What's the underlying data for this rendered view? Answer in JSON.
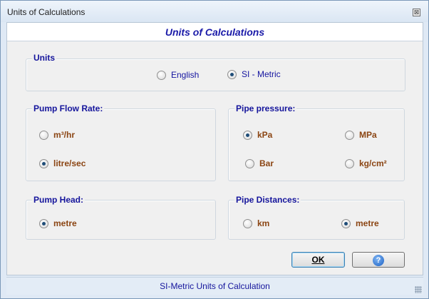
{
  "window": {
    "title": "Units of Calculations"
  },
  "header": {
    "title": "Units of Calculations"
  },
  "units": {
    "label": "Units",
    "options": [
      {
        "label": "English",
        "checked": false
      },
      {
        "label": "SI - Metric",
        "checked": true
      }
    ]
  },
  "pump_flow_rate": {
    "label": "Pump Flow Rate:",
    "options": [
      {
        "label": "m³/hr",
        "checked": false
      },
      {
        "label": "litre/sec",
        "checked": true
      }
    ]
  },
  "pipe_pressure": {
    "label": "Pipe pressure:",
    "options": [
      {
        "label": "kPa",
        "checked": true
      },
      {
        "label": "MPa",
        "checked": false
      },
      {
        "label": "Bar",
        "checked": false
      },
      {
        "label": "kg/cm²",
        "checked": false
      }
    ]
  },
  "pump_head": {
    "label": "Pump Head:",
    "options": [
      {
        "label": "metre",
        "checked": true
      }
    ]
  },
  "pipe_distances": {
    "label": "Pipe Distances:",
    "options": [
      {
        "label": "km",
        "checked": false
      },
      {
        "label": "metre",
        "checked": true
      }
    ]
  },
  "buttons": {
    "ok_label": "OK",
    "help_glyph": "?"
  },
  "status": {
    "text": "SI-Metric Units of Calculation"
  },
  "colors": {
    "group_label": "#15159c",
    "option_label": "#8b4513",
    "header_title": "#1a1aa8"
  }
}
